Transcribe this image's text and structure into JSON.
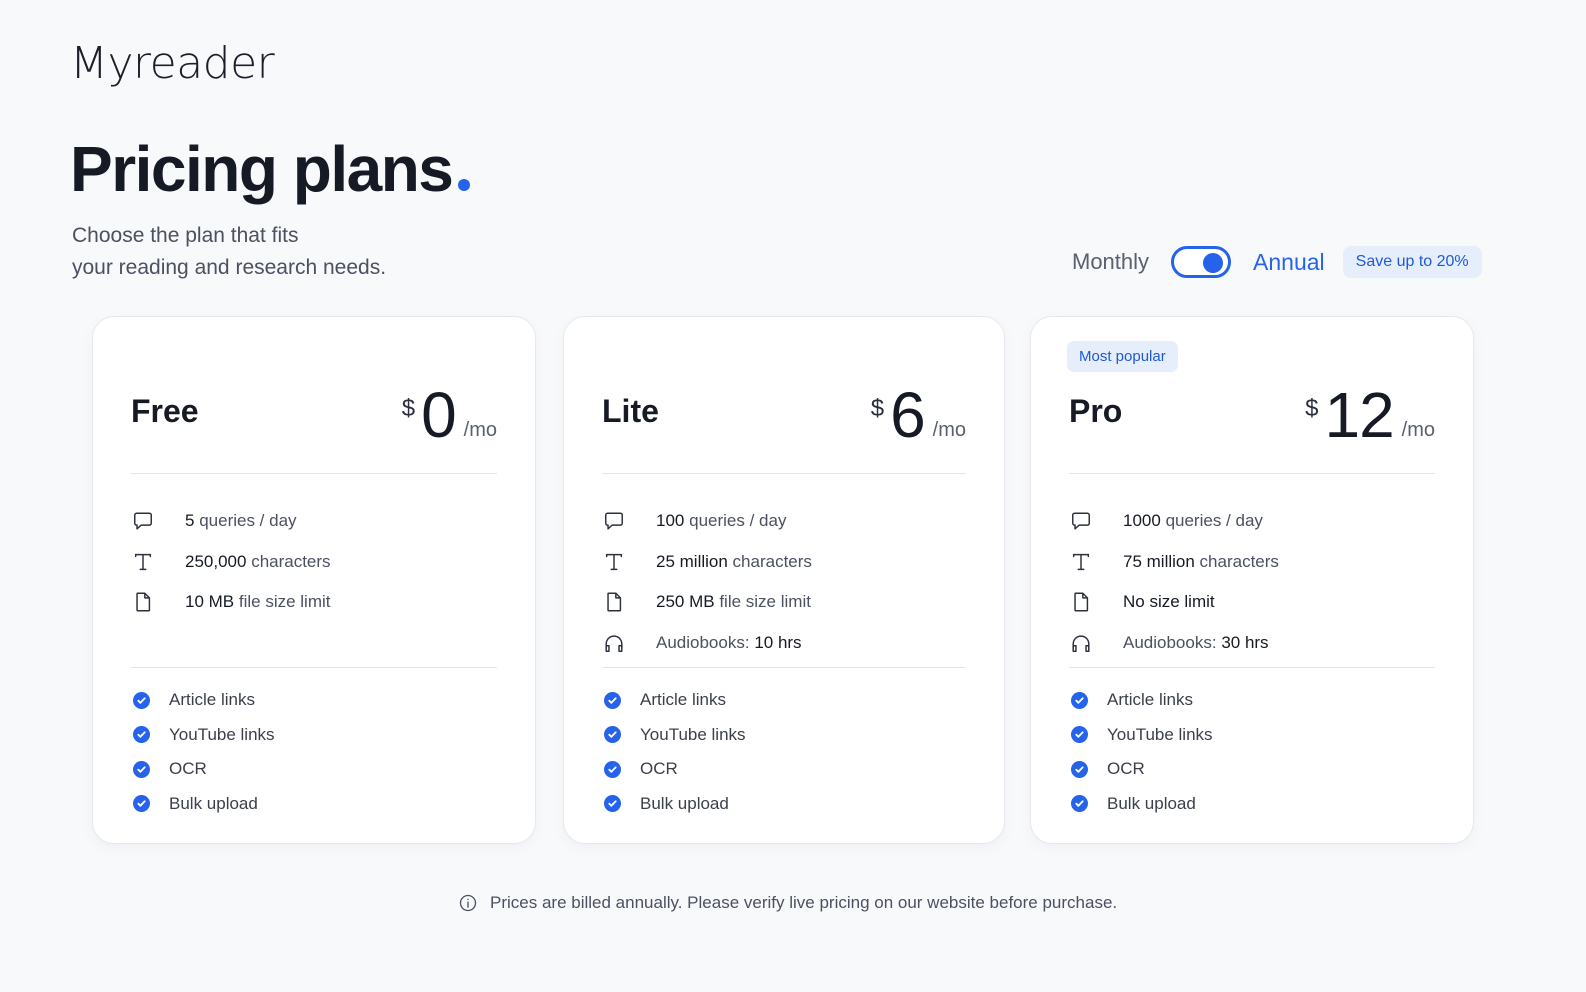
{
  "brand": {
    "logo_text": "Myreader"
  },
  "header": {
    "title": "Pricing plans",
    "subtitle_line1": "Choose the plan that fits",
    "subtitle_line2": "your reading and research needs."
  },
  "billing": {
    "monthly_label": "Monthly",
    "annual_label": "Annual",
    "selected": "Annual",
    "save_badge": "Save up to 20%"
  },
  "colors": {
    "accent": "#2563eb",
    "badge_bg": "#e6eefc",
    "text": "#161a24"
  },
  "plans": [
    {
      "name": "Free",
      "currency": "$",
      "price": "0",
      "period": "/mo",
      "badge": "",
      "quota": [
        {
          "icon": "chat-bubble-icon",
          "value": "5",
          "label": "queries / day"
        },
        {
          "icon": "text-t-icon",
          "value": "250,000",
          "label": "characters"
        },
        {
          "icon": "file-icon",
          "value": "10 MB",
          "label": "file size limit"
        }
      ],
      "features": [
        "Article links",
        "YouTube links",
        "OCR",
        "Bulk upload"
      ]
    },
    {
      "name": "Lite",
      "currency": "$",
      "price": "6",
      "period": "/mo",
      "badge": "",
      "quota": [
        {
          "icon": "chat-bubble-icon",
          "value": "100",
          "label": "queries / day"
        },
        {
          "icon": "text-t-icon",
          "value": "25 million",
          "label": "characters"
        },
        {
          "icon": "file-icon",
          "value": "250 MB",
          "label": "file size limit"
        },
        {
          "icon": "headphones-icon",
          "label": "Audiobooks:",
          "value": "10 hrs"
        }
      ],
      "features": [
        "Article links",
        "YouTube links",
        "OCR",
        "Bulk upload"
      ]
    },
    {
      "name": "Pro",
      "currency": "$",
      "price": "12",
      "period": "/mo",
      "badge": "Most popular",
      "quota": [
        {
          "icon": "chat-bubble-icon",
          "value": "1000",
          "label": "queries / day"
        },
        {
          "icon": "text-t-icon",
          "value": "75 million",
          "label": "characters"
        },
        {
          "icon": "file-icon",
          "value": "No size limit",
          "label": ""
        },
        {
          "icon": "headphones-icon",
          "label": "Audiobooks:",
          "value": "30 hrs"
        }
      ],
      "features": [
        "Article links",
        "YouTube links",
        "OCR",
        "Bulk upload"
      ]
    }
  ],
  "footer": {
    "note": "Prices are billed annually. Please verify live pricing on our website before purchase.",
    "icon": "info-icon"
  }
}
